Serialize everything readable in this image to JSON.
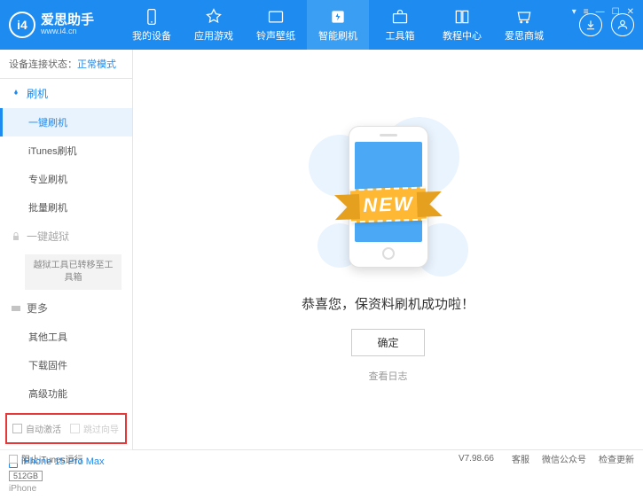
{
  "app": {
    "name": "爱思助手",
    "url": "www.i4.cn"
  },
  "nav": {
    "items": [
      {
        "label": "我的设备"
      },
      {
        "label": "应用游戏"
      },
      {
        "label": "铃声壁纸"
      },
      {
        "label": "智能刷机"
      },
      {
        "label": "工具箱"
      },
      {
        "label": "教程中心"
      },
      {
        "label": "爱思商城"
      }
    ]
  },
  "status": {
    "label": "设备连接状态：",
    "value": "正常模式"
  },
  "sidebar": {
    "flash_group": "刷机",
    "items_flash": [
      "一键刷机",
      "iTunes刷机",
      "专业刷机",
      "批量刷机"
    ],
    "jailbreak_group": "一键越狱",
    "jailbreak_notice": "越狱工具已转移至工具箱",
    "more_group": "更多",
    "items_more": [
      "其他工具",
      "下载固件",
      "高级功能"
    ]
  },
  "checks": {
    "auto_activate": "自动激活",
    "skip_guide": "跳过向导"
  },
  "device": {
    "name": "iPhone 15 Pro Max",
    "storage": "512GB",
    "type": "iPhone"
  },
  "main": {
    "new_badge": "NEW",
    "message": "恭喜您，保资料刷机成功啦！",
    "ok": "确定",
    "view_log": "查看日志"
  },
  "footer": {
    "block_itunes": "阻止iTunes运行",
    "version": "V7.98.66",
    "links": [
      "客服",
      "微信公众号",
      "检查更新"
    ]
  }
}
